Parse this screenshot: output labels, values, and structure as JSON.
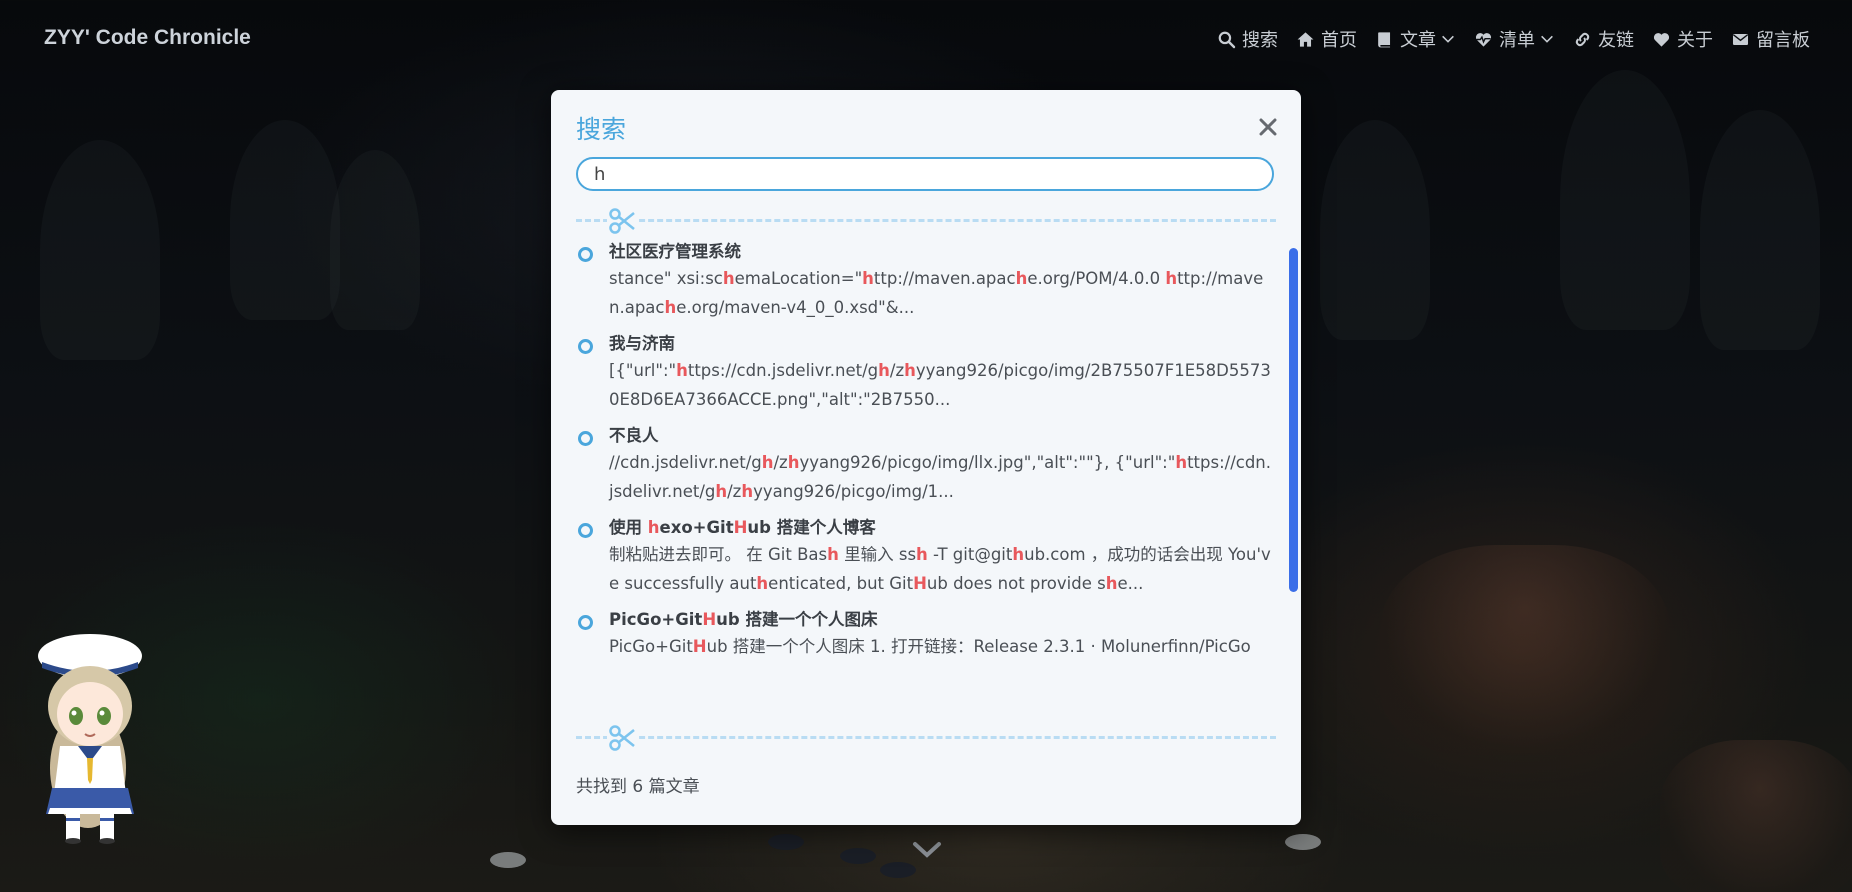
{
  "navbar": {
    "brand": "ZYY' Code Chronicle",
    "items": [
      {
        "label": "搜索",
        "icon": "search-icon"
      },
      {
        "label": "首页",
        "icon": "home-icon"
      },
      {
        "label": "文章",
        "icon": "book-icon",
        "dropdown": true
      },
      {
        "label": "清单",
        "icon": "heartbeat-icon",
        "dropdown": true
      },
      {
        "label": "友链",
        "icon": "link-icon"
      },
      {
        "label": "关于",
        "icon": "heart-icon"
      },
      {
        "label": "留言板",
        "icon": "envelope-icon"
      }
    ]
  },
  "search_modal": {
    "title": "搜索",
    "query": "h",
    "results": [
      {
        "title": [
          {
            "t": "社区医疗管理系统"
          }
        ],
        "snippet": [
          {
            "t": "stance\" xsi:sc"
          },
          {
            "t": "h",
            "hl": true
          },
          {
            "t": "emaLocation=\""
          },
          {
            "t": "h",
            "hl": true
          },
          {
            "t": "ttp://maven.apac"
          },
          {
            "t": "h",
            "hl": true
          },
          {
            "t": "e.org/POM/4.0.0 "
          },
          {
            "t": "h",
            "hl": true
          },
          {
            "t": "ttp://maven.apac"
          },
          {
            "t": "h",
            "hl": true
          },
          {
            "t": "e.org/maven-v4_0_0.xsd\"&..."
          }
        ]
      },
      {
        "title": [
          {
            "t": "我与济南"
          }
        ],
        "snippet": [
          {
            "t": "[{\"url\":\""
          },
          {
            "t": "h",
            "hl": true
          },
          {
            "t": "ttps://cdn.jsdelivr.net/g"
          },
          {
            "t": "h",
            "hl": true
          },
          {
            "t": "/z"
          },
          {
            "t": "h",
            "hl": true
          },
          {
            "t": "yyang926/picgo/img/2B75507F1E58D55730E8D6EA7366ACCE.png\",\"alt\":\"2B7550..."
          }
        ]
      },
      {
        "title": [
          {
            "t": "不良人"
          }
        ],
        "snippet": [
          {
            "t": "//cdn.jsdelivr.net/g"
          },
          {
            "t": "h",
            "hl": true
          },
          {
            "t": "/z"
          },
          {
            "t": "h",
            "hl": true
          },
          {
            "t": "yyang926/picgo/img/llx.jpg\",\"alt\":\"\"}, {\"url\":\""
          },
          {
            "t": "h",
            "hl": true
          },
          {
            "t": "ttps://cdn.jsdelivr.net/g"
          },
          {
            "t": "h",
            "hl": true
          },
          {
            "t": "/z"
          },
          {
            "t": "h",
            "hl": true
          },
          {
            "t": "yyang926/picgo/img/1..."
          }
        ]
      },
      {
        "title": [
          {
            "t": "使用 "
          },
          {
            "t": "h",
            "hl": true
          },
          {
            "t": "exo+Git"
          },
          {
            "t": "H",
            "hl": true
          },
          {
            "t": "ub 搭建个人博客"
          }
        ],
        "snippet": [
          {
            "t": "制粘贴进去即可。 在 Git Bas"
          },
          {
            "t": "h",
            "hl": true
          },
          {
            "t": " 里输入 ss"
          },
          {
            "t": "h",
            "hl": true
          },
          {
            "t": " -T git@git"
          },
          {
            "t": "h",
            "hl": true
          },
          {
            "t": "ub.com ，成功的话会出现 You've successfully aut"
          },
          {
            "t": "h",
            "hl": true
          },
          {
            "t": "enticated, but Git"
          },
          {
            "t": "H",
            "hl": true
          },
          {
            "t": "ub does not provide s"
          },
          {
            "t": "h",
            "hl": true
          },
          {
            "t": "e..."
          }
        ]
      },
      {
        "title": [
          {
            "t": "PicGo+Git"
          },
          {
            "t": "H",
            "hl": true
          },
          {
            "t": "ub 搭建一个个人图床"
          }
        ],
        "snippet": [
          {
            "t": "PicGo+Git"
          },
          {
            "t": "H",
            "hl": true
          },
          {
            "t": "ub 搭建一个个人图床 1. 打开链接：Release 2.3.1 · Molunerfinn/PicGo"
          }
        ]
      }
    ],
    "count_text": "共找到 6 篇文章",
    "scroll_fraction": 0.75
  },
  "colors": {
    "accent": "#4aa6dc",
    "highlight": "#e8585c",
    "scroll_thumb": "#3a6ee8"
  }
}
